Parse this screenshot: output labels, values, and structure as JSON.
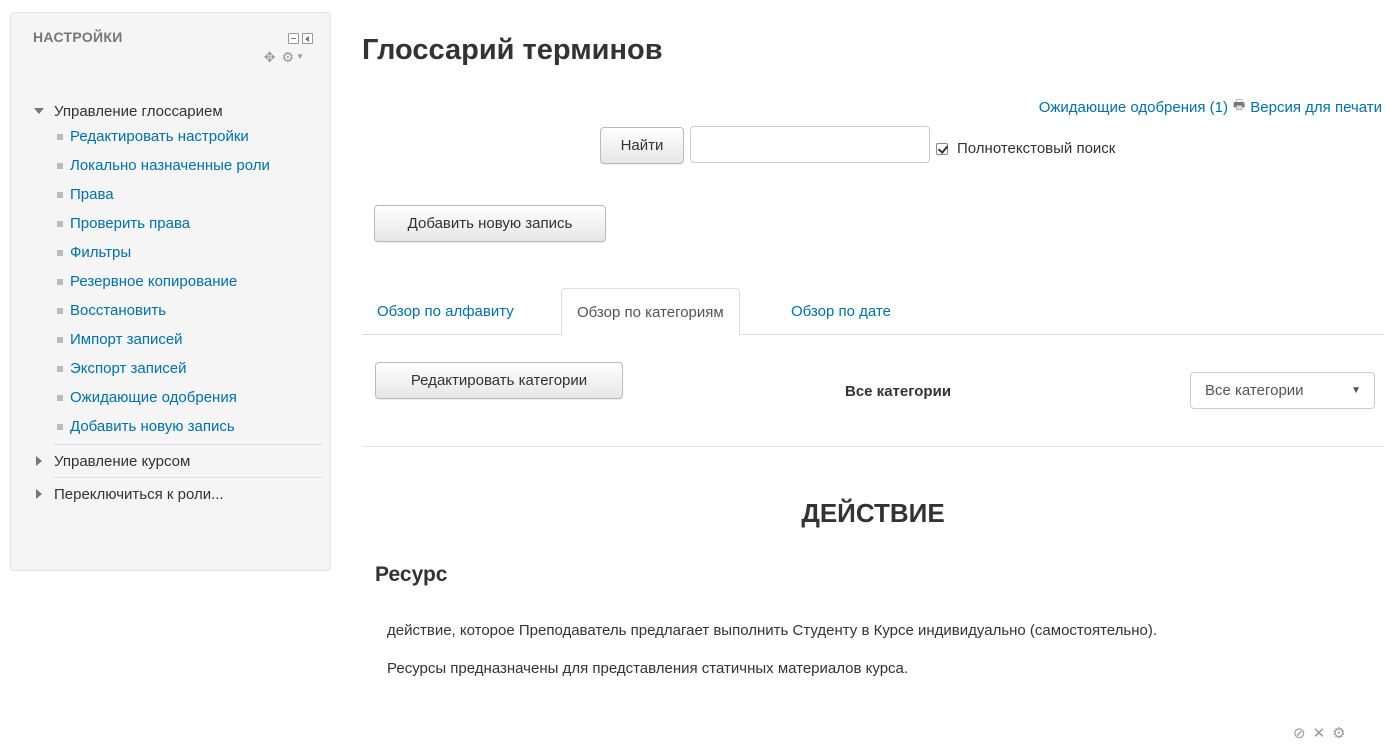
{
  "settings": {
    "title": "НАСТРОЙКИ",
    "glossary_admin": {
      "label": "Управление глоссарием",
      "items": [
        "Редактировать настройки",
        "Локально назначенные роли",
        "Права",
        "Проверить права",
        "Фильтры",
        "Резервное копирование",
        "Восстановить",
        "Импорт записей",
        "Экспорт записей",
        "Ожидающие одобрения",
        "Добавить новую запись"
      ]
    },
    "course_admin": "Управление курсом",
    "switch_role": "Переключиться к роли..."
  },
  "page": {
    "title": "Глоссарий терминов",
    "pending_link": "Ожидающие одобрения (1)",
    "print_link": "Версия для печати",
    "search_button": "Найти",
    "search_value": "",
    "fulltext_label": "Полнотекстовый поиск",
    "fulltext_checked": true,
    "add_entry_button": "Добавить новую запись"
  },
  "tabs": [
    {
      "label": "Обзор по алфавиту",
      "active": false
    },
    {
      "label": "Обзор по категориям",
      "active": true
    },
    {
      "label": "Обзор по дате",
      "active": false
    }
  ],
  "categories": {
    "edit_button": "Редактировать категории",
    "current_label": "Все категории",
    "select_value": "Все категории"
  },
  "content": {
    "section_heading": "ДЕЙСТВИЕ",
    "concept": "Ресурс",
    "definition_lines": [
      "действие, которое Преподаватель предлагает выполнить Студенту в Курсе индивидуально (самостоятельно).",
      "Ресурсы предназначены для представления статичных материалов курса."
    ]
  },
  "icons": {
    "move": "move-icon",
    "gear": "gear-icon",
    "printer": "printer-icon",
    "block": "block-icon",
    "delete": "delete-icon",
    "settings": "gear-icon"
  }
}
